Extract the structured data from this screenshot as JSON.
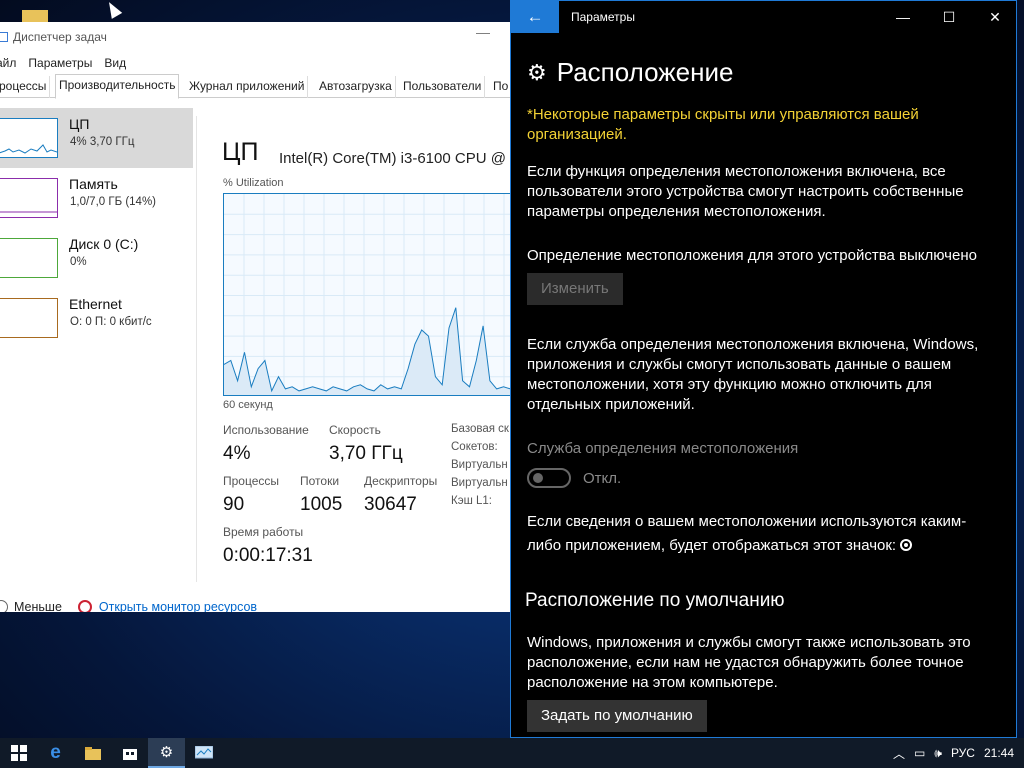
{
  "taskmgr": {
    "title": "Диспетчер задач",
    "menu": [
      "айл",
      "Параметры",
      "Вид"
    ],
    "tabs": [
      "роцессы",
      "Производительность",
      "Журнал приложений",
      "Автозагрузка",
      "Пользователи",
      "По"
    ],
    "sidebar": [
      {
        "name": "ЦП",
        "value": "4% 3,70 ГГц",
        "color": "#1a7dc0"
      },
      {
        "name": "Память",
        "value": "1,0/7,0 ГБ (14%)",
        "color": "#8b2dab"
      },
      {
        "name": "Диск 0 (C:)",
        "value": "0%",
        "color": "#4da83a"
      },
      {
        "name": "Ethernet",
        "value": "О: 0 П: 0 кбит/с",
        "color": "#a86a1f"
      }
    ],
    "cpu_title": "ЦП",
    "cpu_model": "Intel(R) Core(TM) i3-6100 CPU @",
    "util_label": "% Utilization",
    "seconds_label": "60 секунд",
    "stats": {
      "usage_label": "Использование",
      "usage_value": "4%",
      "speed_label": "Скорость",
      "speed_value": "3,70 ГГц",
      "proc_label": "Процессы",
      "proc_value": "90",
      "threads_label": "Потоки",
      "threads_value": "1005",
      "handles_label": "Дескрипторы",
      "handles_value": "30647",
      "uptime_label": "Время работы",
      "uptime_value": "0:00:17:31"
    },
    "right_labels": [
      "Базовая ск",
      "Сокетов:",
      "Виртуальн",
      "Виртуальн",
      "Кэш L1:"
    ],
    "footer_fewer": "Меньше",
    "footer_monitor": "Открыть монитор ресурсов",
    "graph_series": [
      16,
      18,
      8,
      22,
      5,
      14,
      18,
      3,
      10,
      4,
      5,
      3,
      4,
      5,
      4,
      3,
      5,
      4,
      3,
      5,
      6,
      4,
      3,
      6,
      4,
      5,
      4,
      14,
      26,
      33,
      30,
      10,
      6,
      34,
      44,
      8,
      5,
      18,
      35,
      8,
      4,
      5,
      4,
      5,
      3
    ]
  },
  "settings": {
    "app_title": "Параметры",
    "page_title": "Расположение",
    "warning": "*Некоторые параметры скрыты или управляются вашей организацией.",
    "para1": "Если функция определения местоположения включена, все пользователи этого устройства смогут настроить собственные параметры определения местоположения.",
    "device_status": "Определение местоположения для этого устройства выключено",
    "change_button": "Изменить",
    "para2": "Если служба определения местоположения включена, Windows, приложения и службы смогут использовать данные о вашем местоположении, хотя эту функцию можно отключить для отдельных приложений.",
    "service_label": "Служба определения местоположения",
    "toggle_state": "Откл.",
    "para3": "Если сведения о вашем местоположении используются каким-либо приложением, будет отображаться этот значок:",
    "default_heading": "Расположение по умолчанию",
    "para4": "Windows, приложения и службы смогут также использовать это расположение, если нам не удастся обнаружить более точное расположение на этом компьютере.",
    "default_button": "Задать по умолчанию"
  },
  "taskbar": {
    "lang": "РУС",
    "time": "21:44"
  }
}
